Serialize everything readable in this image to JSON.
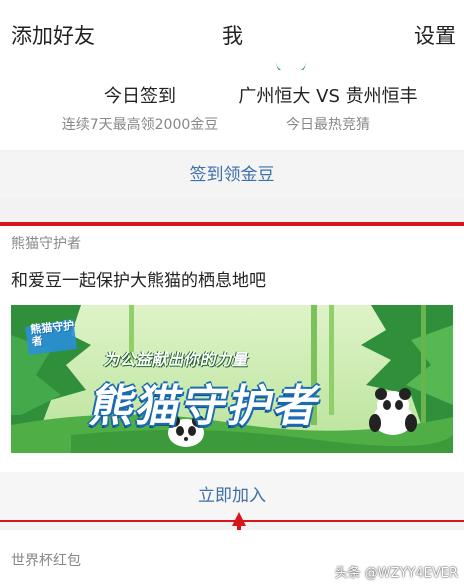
{
  "header": {
    "left_action": "添加好友",
    "title": "我",
    "right_action": "设置"
  },
  "checkin": {
    "left_title": "今日签到",
    "left_sub": "连续7天最高领2000金豆",
    "right_title": "广州恒大 VS 贵州恒丰",
    "right_sub": "今日最热竞猜"
  },
  "signin_button": "签到领金豆",
  "panda_card": {
    "label": "熊猫守护者",
    "description": "和爱豆一起保护大熊猫的栖息地吧",
    "banner": {
      "logo_text": "熊猫守护者",
      "slogan": "为公益献出你的力量",
      "title": "熊猫守护者"
    },
    "join_button": "立即加入"
  },
  "next_card": {
    "label": "世界杯红包"
  },
  "watermark": "头条 @WZYY4EVER",
  "colors": {
    "highlight_border": "#d7161b",
    "link_blue": "#3d6fa8",
    "arrow_red": "#d7161b"
  }
}
